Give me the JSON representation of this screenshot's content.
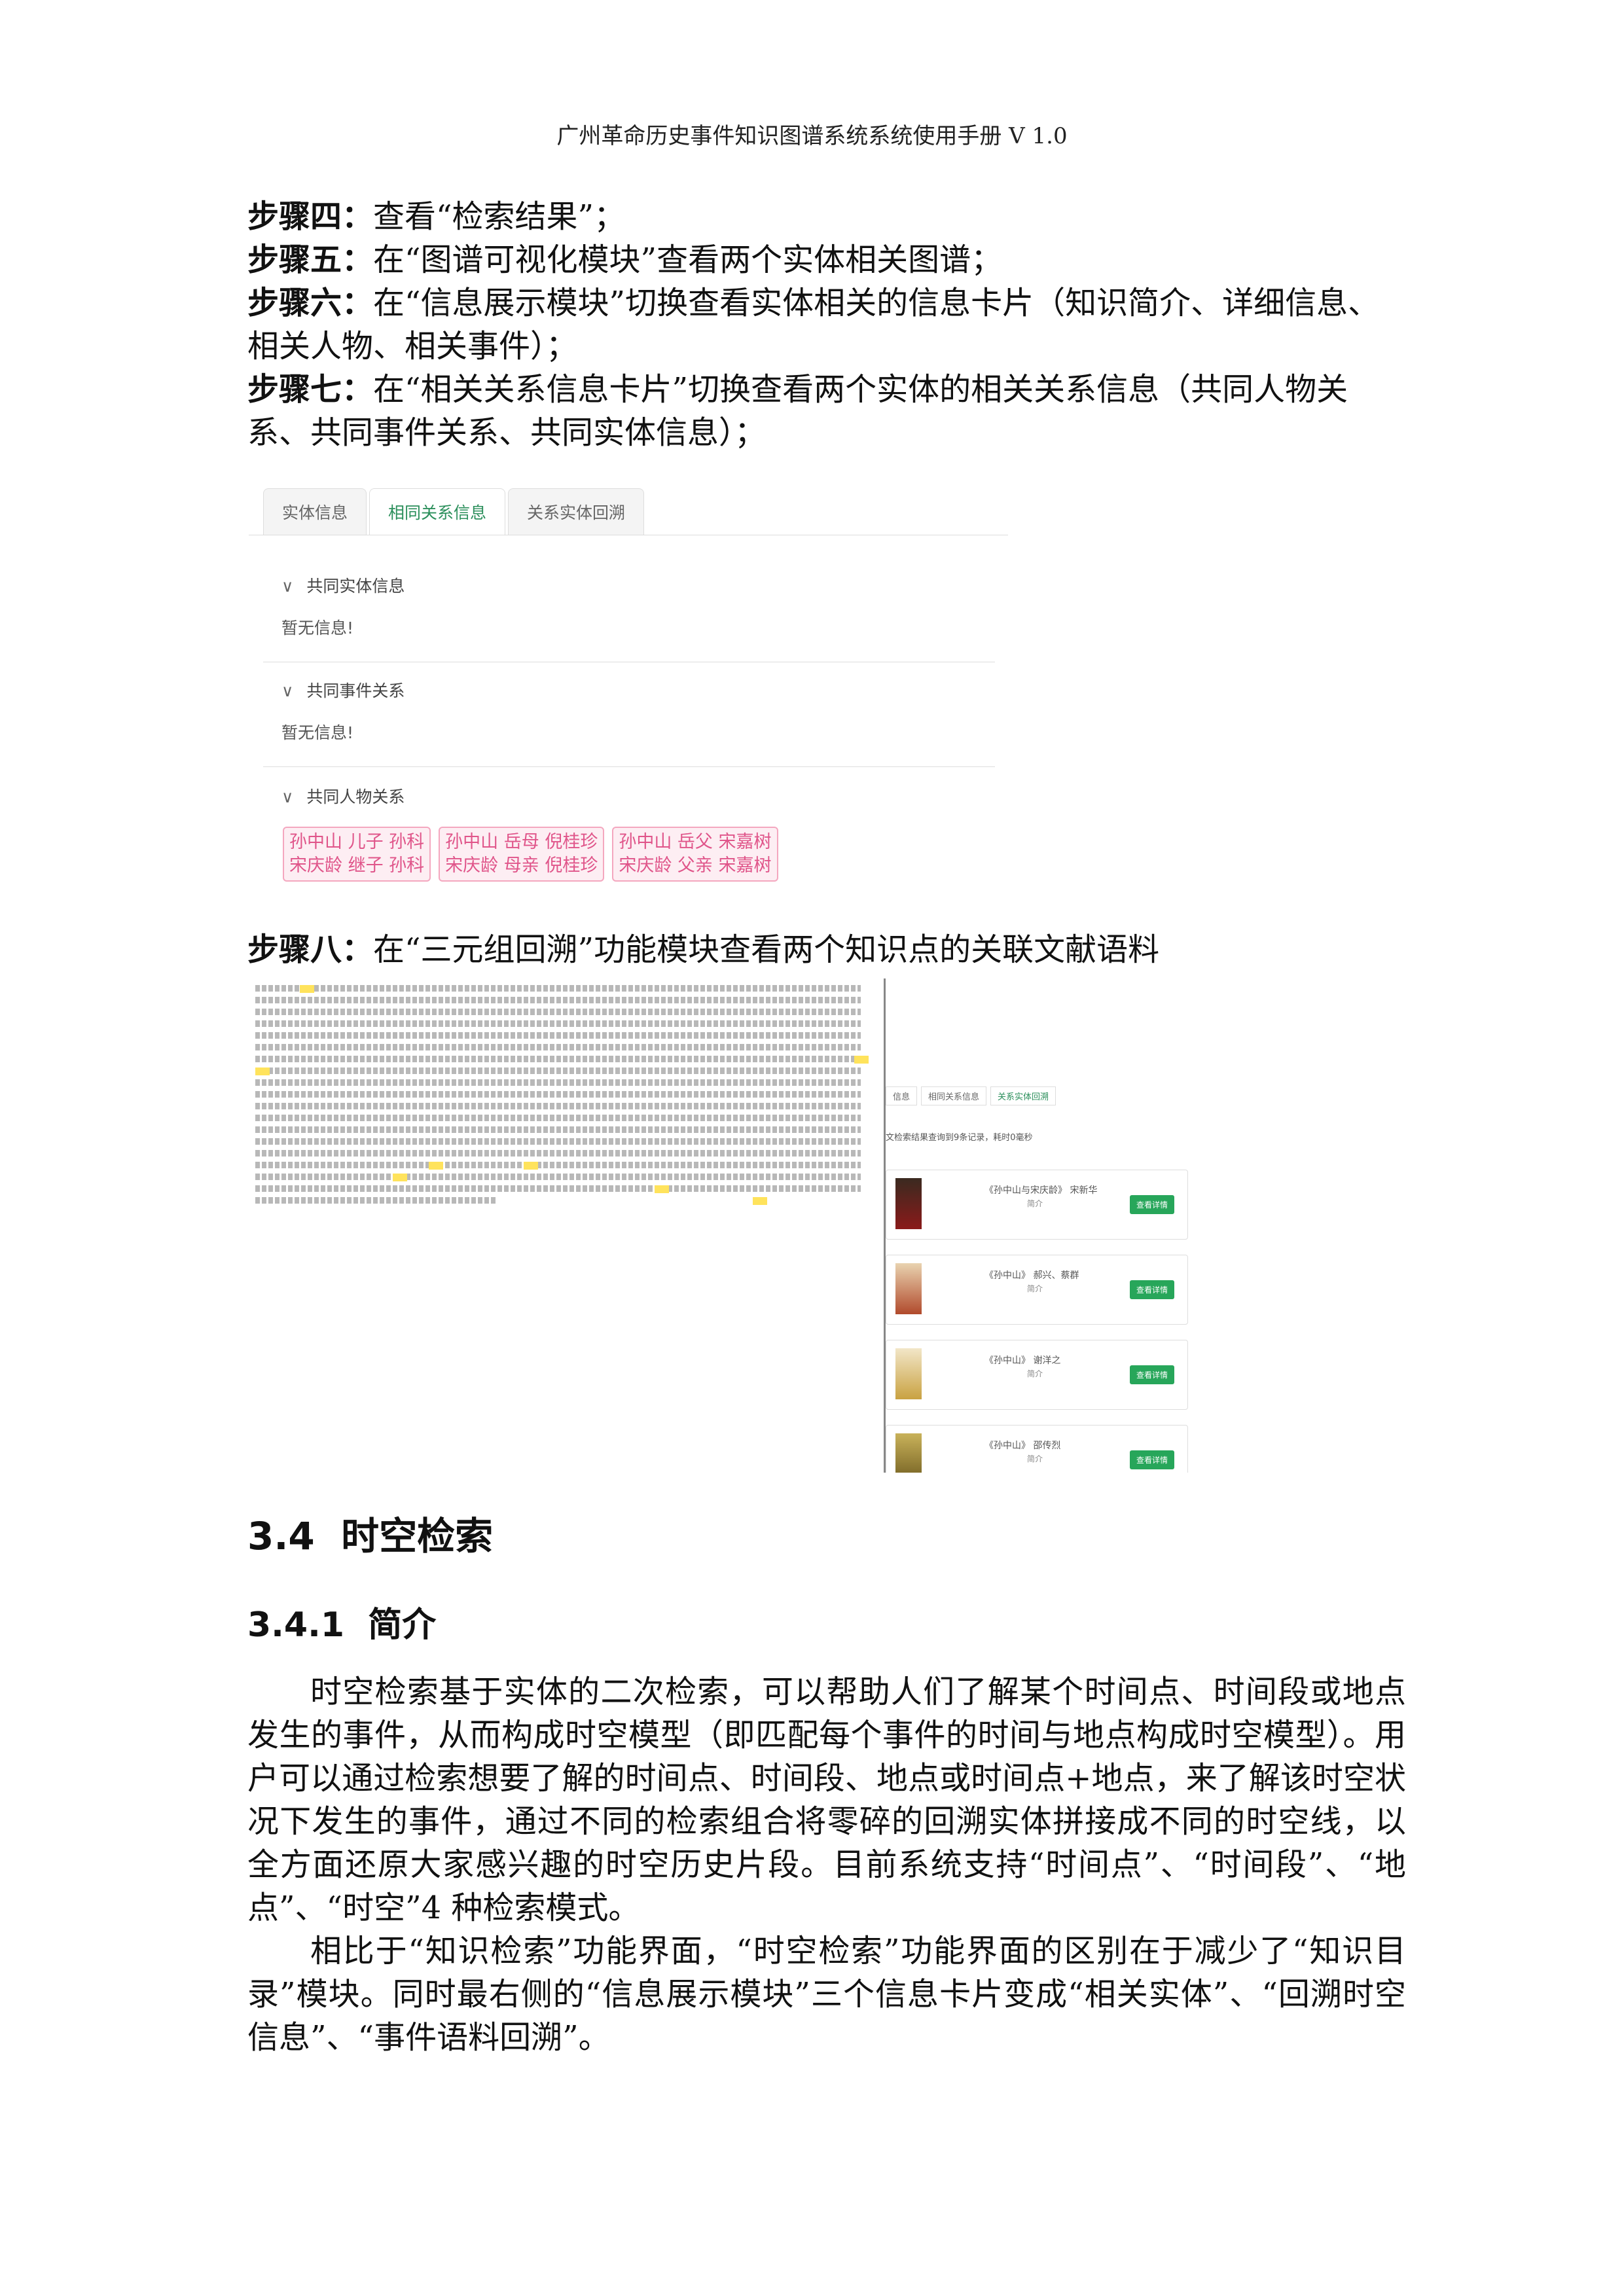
{
  "header": "广州革命历史事件知识图谱系统系统使用手册 V 1.0",
  "steps": [
    {
      "label": "步骤四：",
      "text": "查看“检索结果”；"
    },
    {
      "label": "步骤五：",
      "text": "在“图谱可视化模块”查看两个实体相关图谱；"
    },
    {
      "label": "步骤六：",
      "text": "在“信息展示模块”切换查看实体相关的信息卡片（知识简介、详细信息、相关人物、相关事件）；"
    },
    {
      "label": "步骤七：",
      "text": "在“相关关系信息卡片”切换查看两个实体的相关关系信息（共同人物关系、共同事件关系、共同实体信息）；"
    }
  ],
  "shot1": {
    "tabs": [
      "实体信息",
      "相同关系信息",
      "关系实体回溯"
    ],
    "sections": [
      {
        "title": "共同实体信息",
        "empty": "暂无信息!"
      },
      {
        "title": "共同事件关系",
        "empty": "暂无信息!"
      },
      {
        "title": "共同人物关系"
      }
    ],
    "tags": [
      [
        "孙中山 儿子 孙科",
        "宋庆龄 继子 孙科"
      ],
      [
        "孙中山 岳母 倪桂珍",
        "宋庆龄 母亲 倪桂珍"
      ],
      [
        "孙中山 岳父 宋嘉树",
        "宋庆龄 父亲 宋嘉树"
      ]
    ]
  },
  "step8": {
    "label": "步骤八：",
    "text": "在“三元组回溯”功能模块查看两个知识点的关联文献语料"
  },
  "shot2": {
    "tabs": [
      "信息",
      "相同关系信息",
      "关系实体回溯"
    ],
    "info": "文检索结果查询到9条记录，耗时0毫秒",
    "cards": [
      {
        "title": "《孙中山与宋庆龄》 宋新华",
        "sub": "简介",
        "button": "查看详情"
      },
      {
        "title": "《孙中山》 郝兴、蔡群",
        "sub": "简介",
        "button": "查看详情"
      },
      {
        "title": "《孙中山》 谢洋之",
        "sub": "简介",
        "button": "查看详情"
      },
      {
        "title": "《孙中山》 邵传烈",
        "sub": "简介",
        "button": "查看详情"
      }
    ]
  },
  "section": {
    "number": "3.4",
    "title": "时空检索"
  },
  "subsection": {
    "number": "3.4.1",
    "title": "简介"
  },
  "paragraphs": [
    "时空检索基于实体的二次检索，可以帮助人们了解某个时间点、时间段或地点发生的事件，从而构成时空模型（即匹配每个事件的时间与地点构成时空模型）。用户可以通过检索想要了解的时间点、时间段、地点或时间点+地点，来了解该时空状况下发生的事件，通过不同的检索组合将零碎的回溯实体拼接成不同的时空线，以全方面还原大家感兴趣的时空历史片段。目前系统支持“时间点”、“时间段”、“地点”、“时空”4 种检索模式。",
    "相比于“知识检索”功能界面，“时空检索”功能界面的区别在于减少了“知识目录”模块。同时最右侧的“信息展示模块”三个信息卡片变成“相关实体”、“回溯时空信息”、“事件语料回溯”。"
  ]
}
